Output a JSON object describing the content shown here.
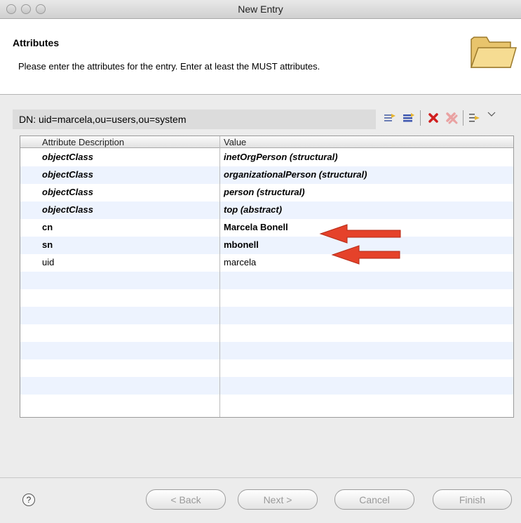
{
  "window": {
    "title": "New Entry"
  },
  "header": {
    "title": "Attributes",
    "message": "Please enter the attributes for the entry. Enter at least the MUST attributes.",
    "icon": "folder-icon"
  },
  "dn": {
    "label": "DN: uid=marcela,ou=users,ou=system"
  },
  "toolbar": {
    "icons": [
      "new-attribute-icon",
      "new-value-icon",
      "delete-icon",
      "delete-all-icon",
      "expand-icon",
      "view-menu-chevron-icon"
    ]
  },
  "table": {
    "headers": {
      "attribute": "Attribute Description",
      "value": "Value"
    },
    "rows": [
      {
        "attribute": "objectClass",
        "value": "inetOrgPerson (structural)"
      },
      {
        "attribute": "objectClass",
        "value": "organizationalPerson (structural)"
      },
      {
        "attribute": "objectClass",
        "value": "person (structural)"
      },
      {
        "attribute": "objectClass",
        "value": "top (abstract)"
      },
      {
        "attribute": "cn",
        "value": "Marcela Bonell"
      },
      {
        "attribute": "sn",
        "value": "mbonell"
      },
      {
        "attribute": "uid",
        "value": "marcela"
      }
    ]
  },
  "buttons": {
    "back": "< Back",
    "next": "Next >",
    "cancel": "Cancel",
    "finish": "Finish"
  },
  "help": {
    "label": "?"
  },
  "colors": {
    "annotation_arrow": "#e5422a",
    "row_stripe": "#edf3fe"
  }
}
